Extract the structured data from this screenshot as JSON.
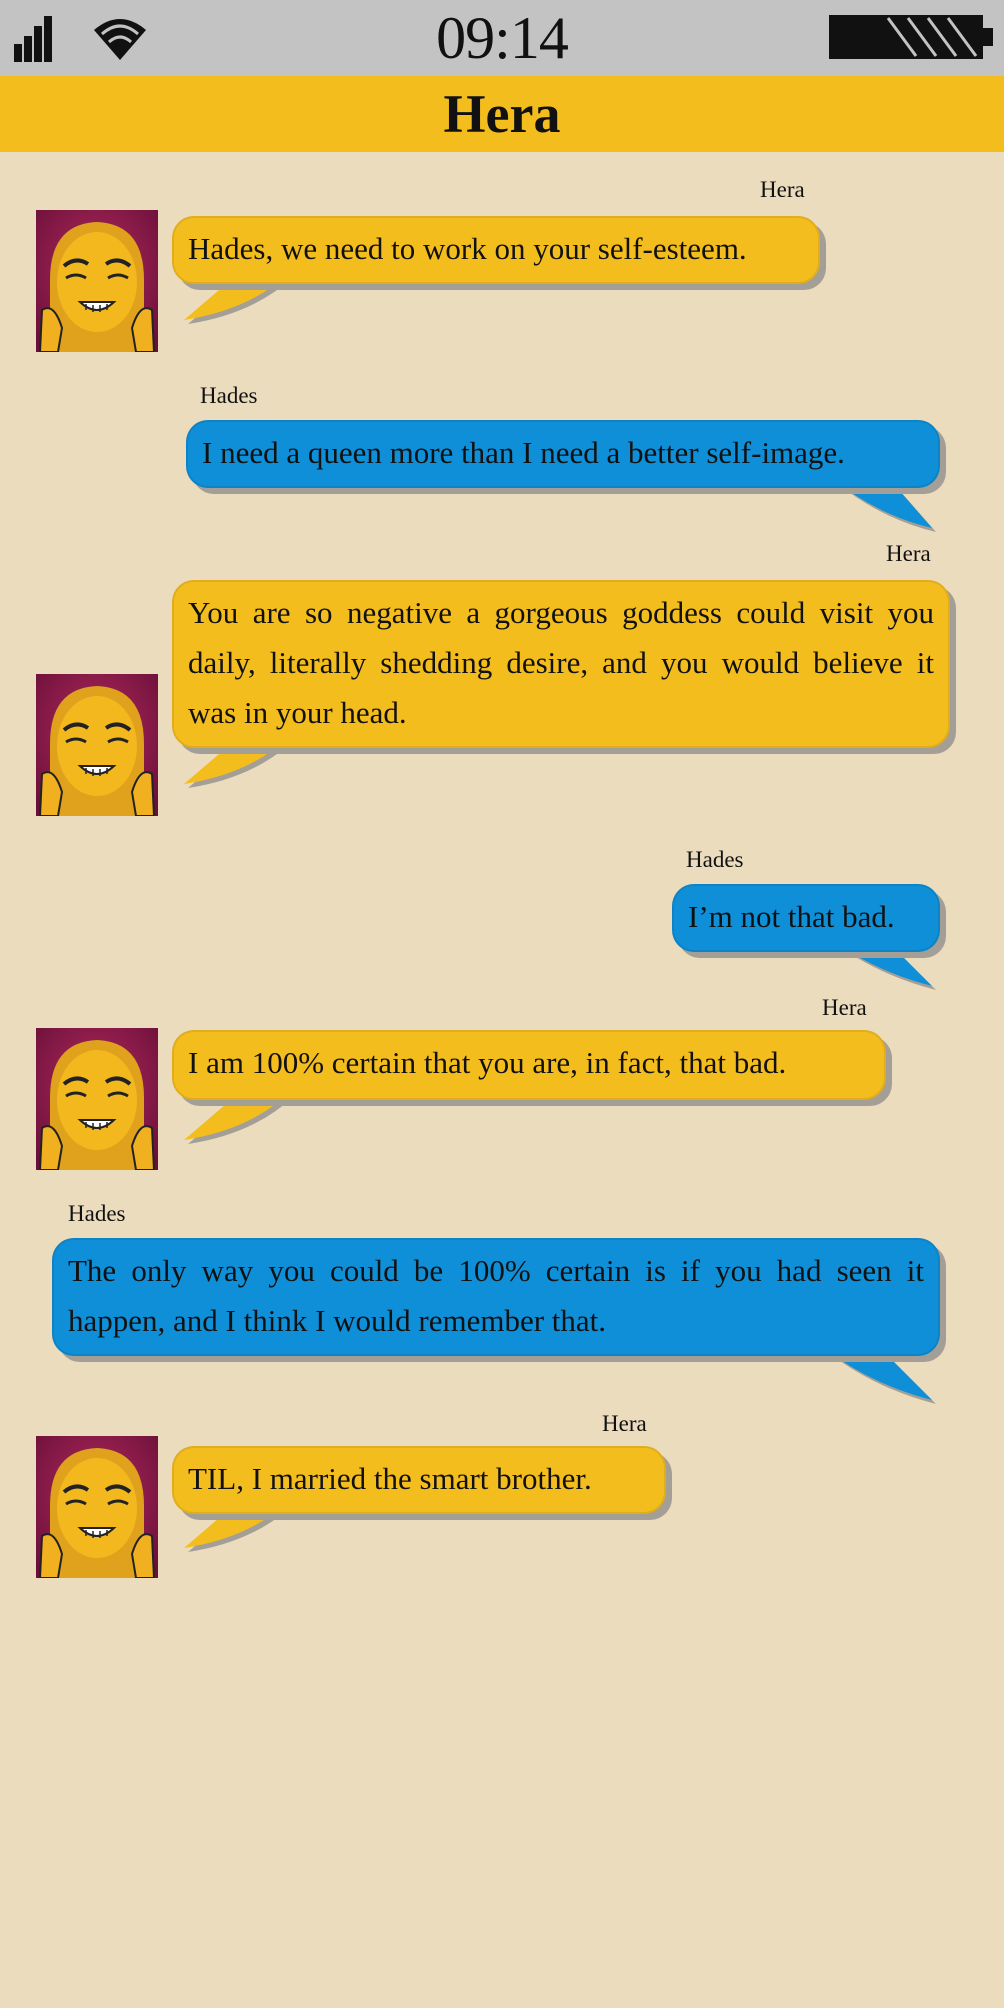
{
  "status_bar": {
    "time": "09:14",
    "icons": [
      "signal-icon",
      "wifi-icon",
      "battery-icon"
    ]
  },
  "header": {
    "title": "Hera"
  },
  "messages": [
    {
      "sender": "Hera",
      "text": "Hades, we need to work on your self-esteem."
    },
    {
      "sender": "Hades",
      "text": "I need a queen more than I need a better self-image."
    },
    {
      "sender": "Hera",
      "text": "You are so negative a gorgeous goddess could visit you daily, literally shedding desire, and you would believe it was in your head."
    },
    {
      "sender": "Hades",
      "text": "I’m not that bad."
    },
    {
      "sender": "Hera",
      "text": "I am 100% certain that you are, in fact, that bad."
    },
    {
      "sender": "Hades",
      "text": "The only way you could be 100% certain is if you had seen it happen, and I think I would remember that."
    },
    {
      "sender": "Hera",
      "text": "TIL, I married the smart brother."
    }
  ],
  "colors": {
    "background": "#ecdcbe",
    "status_bar": "#c3c3c3",
    "header": "#f4bd1e",
    "hera_bubble": "#f4bd1e",
    "hades_bubble": "#0e8fd8"
  }
}
